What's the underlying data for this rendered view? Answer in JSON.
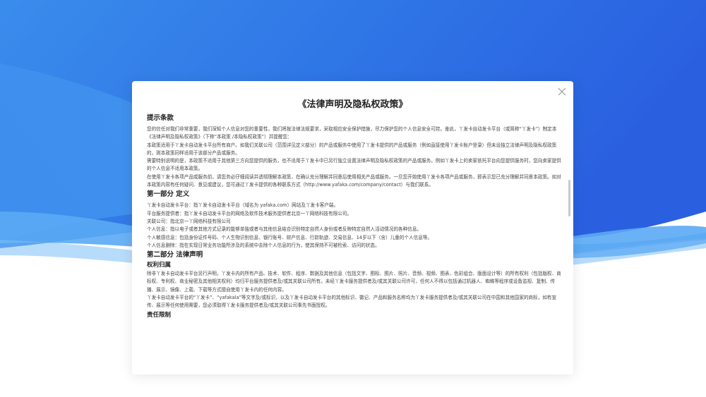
{
  "colors": {
    "bg_top": "#2d6fe8",
    "bg_mid": "#4a9af0",
    "wave_light": "#5fb0f5",
    "modal_bg": "#ffffff"
  },
  "modal": {
    "title": "《法律声明及隐私权政策》",
    "close_icon": "close-icon",
    "sections": {
      "tips": {
        "heading": "提示条款",
        "paragraphs": [
          "您的信任对我们非常重要，我们深知个人信息对您的重要性，我们将按法律法规要求，采取相应安全保护措施，尽力保护您的个人信息安全可控。鉴此，丫发卡自动发卡平台（或简称“丫发卡”）制定本《法律声明及隐私权政策》（下称“本政策 /本隐私权政策”）并提醒您：",
          "本政策适用于丫发卡自动发卡平台所有商户。如我们关联公司（范围详见定义部分）的产品或服务中使用了丫发卡提供的产品或服务（例如直接使用丫发卡账户登录）但未设独立法律声明及隐私权政策的，则本政策同样适用于该部分产品或服务。",
          "需要特别说明的是，本政策不适用于其他第三方向您提供的服务，也不适用于丫发卡中已另行独立设置法律声明及隐私权政策的产品或服务。例如丫发卡上的卖家依托平台向您提供服务时，您向卖家提供的个人信息不适用本政策。",
          "在使用丫发卡各项产品或服务前，请您务必仔细阅读并透彻理解本政策，在确认充分理解并同意后使用相关产品或服务。一旦您开始使用丫发卡各项产品或服务，即表示您已充分理解并同意本政策。如对本政策内容有任何疑问、意见或建议，您可通过丫发卡提供的各种联系方式（http://www.yafaka.com/company/contact）与我们联系。"
        ]
      },
      "part1": {
        "heading": "第一部分 定义",
        "paragraphs": [
          "丫发卡自动发卡平台：指丫发卡自动发卡平台（域名为 yafaka.com）网站及丫发卡客户端。",
          "平台服务提供者：指丫发卡自动发卡平台的网络及软件技术服务提供者北京一丫网络科技有限公司。",
          "关联公司：指北京一丫网络科技有限公司",
          "个人信息：指以电子或者其他方式记录的能够单独或者与其他信息结合识别特定自然人身份或者反映特定自然人活动情况的各种信息。",
          "个人敏感信息：包括身份证件号码、个人生物识别信息、银行账号、财产信息、行踪轨迹、交易信息、14岁以下（含）儿童的个人信息等。",
          "个人信息删除：指在实现日常业务功能所涉及的系统中去除个人信息的行为，使其保持不可被检索、访问的状态。"
        ]
      },
      "part2": {
        "heading": "第二部分 法律声明",
        "subsections": {
          "rights": {
            "heading": "权利归属",
            "paragraphs": [
              "除非丫发卡自动发卡平台另行声明，丫发卡内的所有产品、技术、软件、程序、数据及其他信息（包括文字、图标、图片、照片、音频、视频、图表、色彩组合、版面设计等）的所有权利（包括版权、商标权、专利权、商业秘密及其他相关权利）均归平台服务提供者及/或其关联公司所有。未经丫发卡服务提供者及/或其关联公司许可，任何人不得以包括通过机器人、蜘蛛等程序或设备监视、复制、传播、展示、镜像、上载、下载等方式擅自使用丫发卡内的任何内容。",
              "丫发卡自动发卡平台的“丫发卡”、“yafakala”等文字及/或标识，以及丫发卡自动发卡平台的其他标识、徽记、产品和服务名称均为丫发卡服务提供者及/或其关联公司在中国和其他国家的商标，如有宣传、展示等任何使用需要，您必须取得丫发卡服务提供者及/或其关联公司事先书面授权。"
            ]
          },
          "liability": {
            "heading": "责任限制"
          }
        }
      }
    }
  }
}
